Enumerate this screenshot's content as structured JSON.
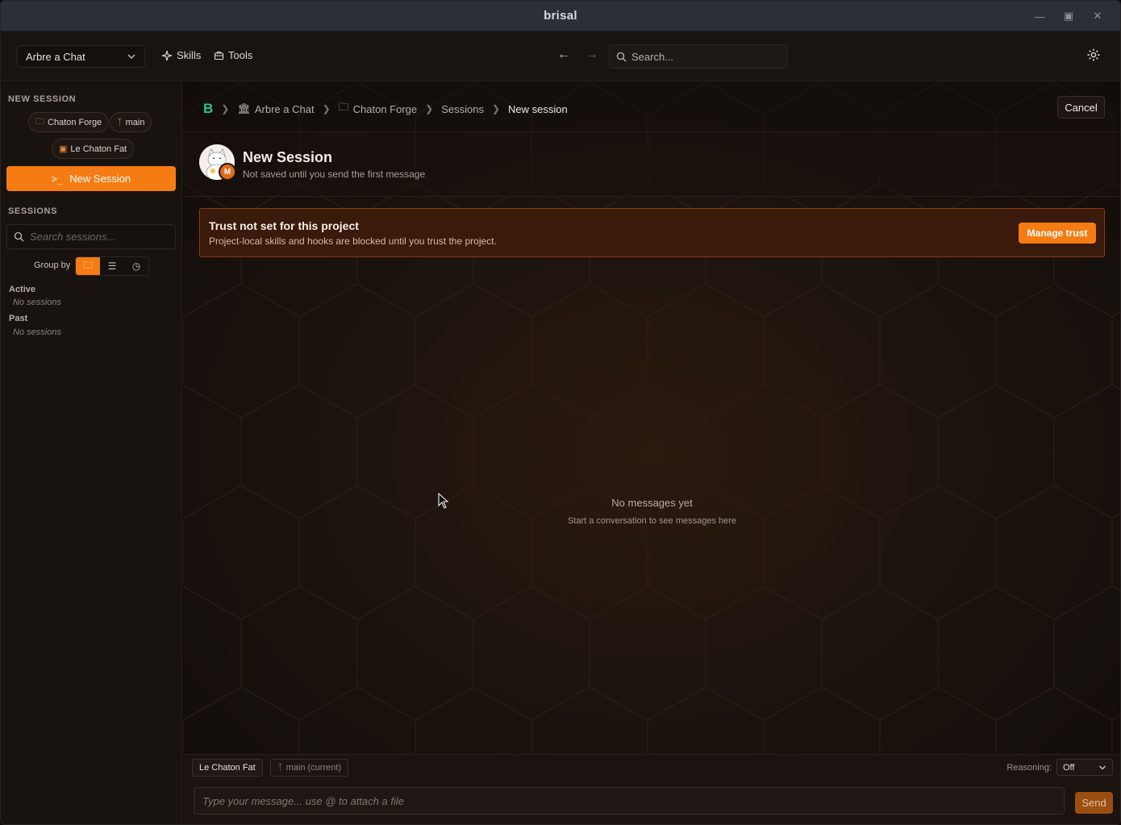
{
  "window": {
    "title": "brisal"
  },
  "toolbar": {
    "project": "Arbre a Chat",
    "skills": "Skills",
    "tools": "Tools",
    "search_placeholder": "Search..."
  },
  "sidebar": {
    "new_session_title": "NEW SESSION",
    "chips": {
      "project": "Chaton Forge",
      "branch": "main",
      "agent": "Le Chaton Fat"
    },
    "new_session_button": "New Session",
    "sessions_title": "SESSIONS",
    "search_placeholder": "Search sessions...",
    "group_by": "Group by",
    "groups": [
      {
        "title": "Active",
        "empty": "No sessions"
      },
      {
        "title": "Past",
        "empty": "No sessions"
      }
    ]
  },
  "breadcrumb": {
    "logo": "B",
    "items": [
      "Arbre a Chat",
      "Chaton Forge",
      "Sessions",
      "New session"
    ],
    "cancel": "Cancel"
  },
  "session": {
    "avatar_badge": "M",
    "title": "New Session",
    "subtitle": "Not saved until you send the first message"
  },
  "trust_banner": {
    "title": "Trust not set for this project",
    "text": "Project-local skills and hooks are blocked until you trust the project.",
    "button": "Manage trust"
  },
  "empty_state": {
    "title": "No messages yet",
    "subtitle": "Start a conversation to see messages here"
  },
  "composer": {
    "model": "Le Chaton Fat",
    "branch": "main (current)",
    "reasoning_label": "Reasoning:",
    "reasoning_value": "Off",
    "placeholder": "Type your message... use @ to attach a file",
    "send": "Send"
  },
  "colors": {
    "accent": "#f57c12",
    "brand_logo": "#24c98b",
    "banner_bg": "#3a1a0a"
  }
}
